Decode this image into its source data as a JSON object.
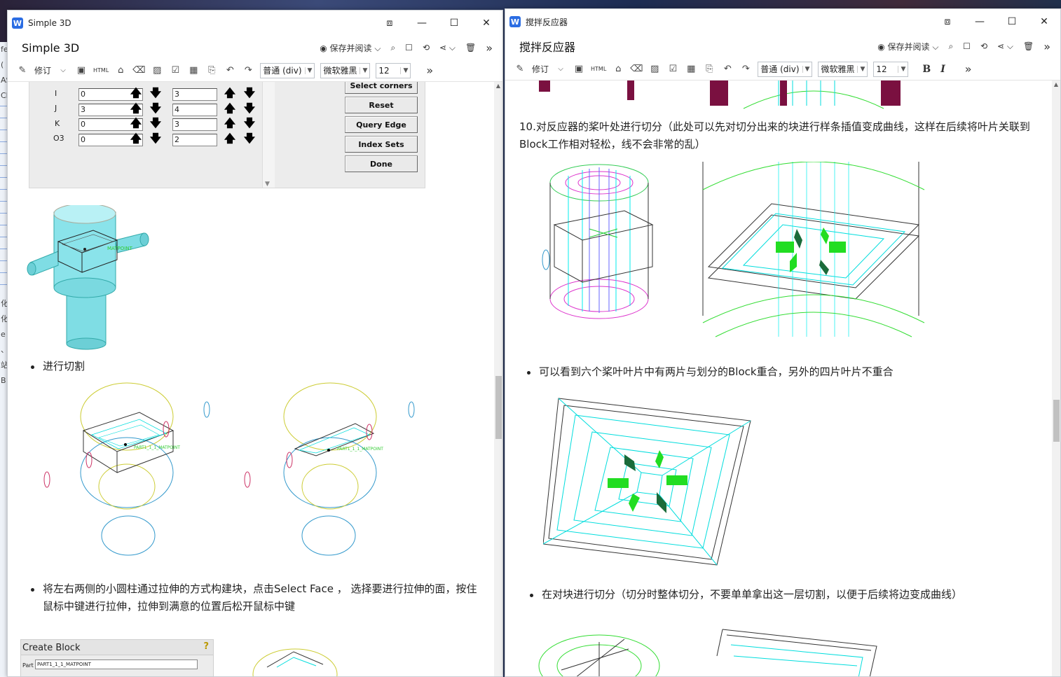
{
  "left_window": {
    "title": "Simple 3D",
    "controls": [
      "⧈",
      "—",
      "☐",
      "✕"
    ],
    "doc_title": "Simple 3D",
    "actions": {
      "save_read": "保存并阅读",
      "more": "»"
    },
    "toolbar": {
      "revise": "修订",
      "html": "HTML",
      "style": "普通 (div)",
      "font": "微软雅黑",
      "size": "12",
      "more": "»"
    },
    "icb_panel": {
      "rows": [
        {
          "label": "I",
          "from": "0",
          "to": "3"
        },
        {
          "label": "J",
          "from": "3",
          "to": "4"
        },
        {
          "label": "K",
          "from": "0",
          "to": "3"
        },
        {
          "label": "O3",
          "from": "0",
          "to": "2"
        }
      ],
      "buttons": [
        "Select corners",
        "Reset",
        "Query Edge",
        "Index Sets",
        "Done"
      ]
    },
    "bullet1": "进行切割",
    "bullet2": "将左右两侧的小圆柱通过拉伸的方式构建块，点击Select Face ， 选择要进行拉伸的面，按住鼠标中键进行拉伸，拉伸到满意的位置后松开鼠标中键",
    "create_block": {
      "title": "Create Block",
      "part_label": "Part",
      "part_value": "PART1_1_1_MATPOINT"
    },
    "model_label": "MATPOINT"
  },
  "right_window": {
    "title": "搅拌反应器",
    "controls": [
      "⧈",
      "—",
      "☐",
      "✕"
    ],
    "doc_title": "搅拌反应器",
    "actions": {
      "save_read": "保存并阅读",
      "more": "»"
    },
    "toolbar": {
      "revise": "修订",
      "html": "HTML",
      "style": "普通 (div)",
      "font": "微软雅黑",
      "size": "12",
      "bold": "B",
      "italic": "I",
      "more": "»"
    },
    "para10": "10.对反应器的桨叶处进行切分（此处可以先对切分出来的块进行样条插值变成曲线，这样在后续将叶片关联到Block工作相对轻松，线不会非常的乱）",
    "bullet1": "可以看到六个桨叶叶片中有两片与划分的Block重合，另外的四片叶片不重合",
    "bullet2": "在对块进行切分（切分时整体切分，不要单单拿出这一层切割，以便于后续将边变成曲线）"
  },
  "desktop_strip": [
    "fe",
    "(",
    "AS",
    "CF",
    "化",
    "化",
    "e",
    "、",
    "站",
    "B"
  ],
  "colors": {
    "accent": "#2b6de3",
    "cyan": "#00e5e5",
    "green": "#33dd33",
    "magenta": "#dd33cc",
    "dark_green": "#1a6b3a"
  }
}
